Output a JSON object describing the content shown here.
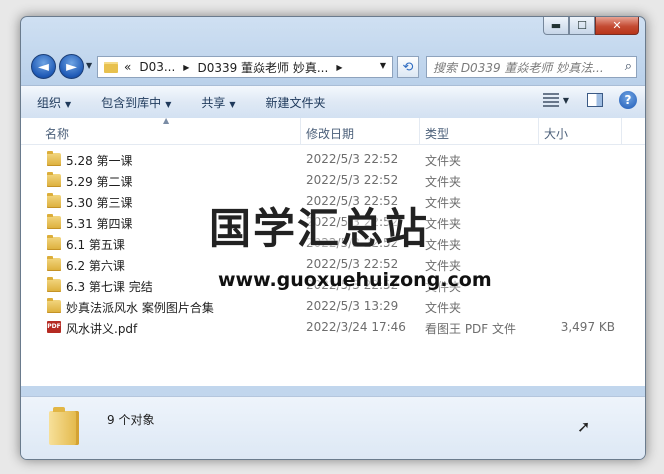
{
  "window": {
    "caption": {
      "minimize": "▬",
      "maximize": "☐",
      "close": "✕"
    }
  },
  "nav": {
    "back": "◄",
    "forward": "►",
    "history_dropdown": "▼",
    "address": {
      "overflow": "«",
      "parts": [
        "D03...",
        "D0339 董焱老师 妙真..."
      ],
      "separator": "▶",
      "dropdown": "▼"
    },
    "refresh": "⟲",
    "search": {
      "placeholder": "搜索 D0339 董焱老师 妙真法...",
      "icon": "⌕"
    }
  },
  "toolbar": {
    "items": [
      {
        "label": "组织",
        "arrow": "▼"
      },
      {
        "label": "包含到库中",
        "arrow": "▼"
      },
      {
        "label": "共享",
        "arrow": "▼"
      },
      {
        "label": "新建文件夹",
        "arrow": ""
      }
    ],
    "view_drop": "▼",
    "help": "?"
  },
  "columns": {
    "name": "名称",
    "date": "修改日期",
    "type": "类型",
    "size": "大小",
    "sort_arrow": "▲"
  },
  "files": [
    {
      "name": "5.28 第一课",
      "date": "2022/5/3 22:52",
      "type": "文件夹",
      "size": "",
      "icon": "folder-icon"
    },
    {
      "name": "5.29 第二课",
      "date": "2022/5/3 22:52",
      "type": "文件夹",
      "size": "",
      "icon": "folder-icon"
    },
    {
      "name": "5.30 第三课",
      "date": "2022/5/3 22:52",
      "type": "文件夹",
      "size": "",
      "icon": "folder-icon"
    },
    {
      "name": "5.31 第四课",
      "date": "2022/5/3 22:52",
      "type": "文件夹",
      "size": "",
      "icon": "folder-icon"
    },
    {
      "name": "6.1 第五课",
      "date": "2022/5/3 22:52",
      "type": "文件夹",
      "size": "",
      "icon": "folder-icon"
    },
    {
      "name": "6.2 第六课",
      "date": "2022/5/3 22:52",
      "type": "文件夹",
      "size": "",
      "icon": "folder-icon"
    },
    {
      "name": "6.3 第七课 完结",
      "date": "2022/5/3 22:52",
      "type": "文件夹",
      "size": "",
      "icon": "folder-icon"
    },
    {
      "name": "妙真法派风水 案例图片合集",
      "date": "2022/5/3 13:29",
      "type": "文件夹",
      "size": "",
      "icon": "folder-icon"
    },
    {
      "name": "风水讲义.pdf",
      "date": "2022/3/24 17:46",
      "type": "看图王 PDF 文件",
      "size": "3,497 KB",
      "icon": "pdf-icon",
      "icon_text": "PDF"
    }
  ],
  "watermark": {
    "title": "国学汇总站",
    "url": "www.guoxuehuizong.com"
  },
  "details": {
    "count": "9 个对象"
  },
  "colors": {
    "accent": "#1f5ab6",
    "folder": "#e2b645",
    "close": "#c44b33"
  }
}
